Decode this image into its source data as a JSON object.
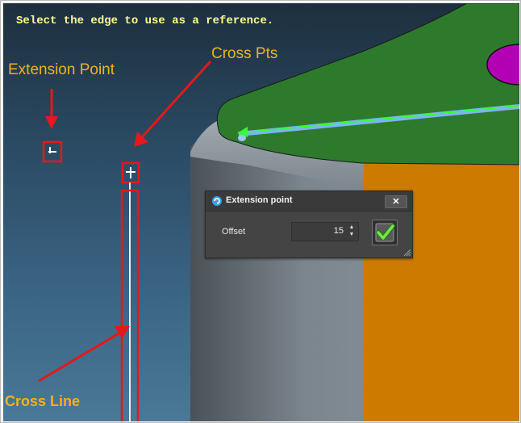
{
  "viewport": {
    "prompt": "Select the edge to use as a reference."
  },
  "annotations": {
    "extension_point": "Extension Point",
    "cross_pts": "Cross Pts",
    "cross_line": "Cross Line"
  },
  "dialog": {
    "title": "Extension point",
    "close_label": "✕",
    "offset_label": "Offset",
    "offset_value": "15"
  },
  "colors": {
    "annotation_text": "#f2b21c",
    "annotation_marker": "#e5181b",
    "prompt_text": "#fbfb96",
    "top_face": "#2d7a2d",
    "side_face": "#cc7a00",
    "cylinder_wall": "#7f8a93",
    "hole": "#b400b4",
    "highlight_edge": "#7fb2ff",
    "preview_arrow": "#33ff33"
  },
  "icons": {
    "dialog_icon": "extension-point-icon",
    "close": "close-icon",
    "ok": "checkmark-icon"
  }
}
